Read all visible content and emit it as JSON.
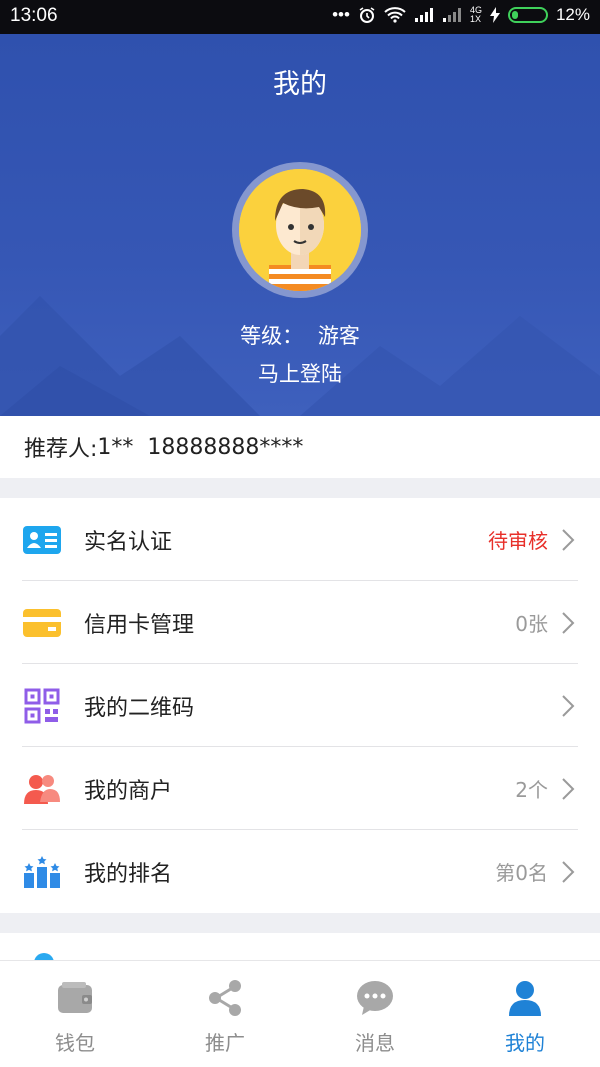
{
  "status_bar": {
    "time": "13:06",
    "network": "4G",
    "network_sub": "1X",
    "battery": "12%"
  },
  "header": {
    "title": "我的",
    "level_label": "等级：",
    "level_value": "游客",
    "login_link": "马上登陆"
  },
  "referrer": {
    "label": "推荐人:",
    "value": "1**  18888888****"
  },
  "menu": {
    "items": [
      {
        "label": "实名认证",
        "value": "待审核",
        "icon": "id-card-icon"
      },
      {
        "label": "信用卡管理",
        "value": "0张",
        "icon": "credit-card-icon"
      },
      {
        "label": "我的二维码",
        "value": "",
        "icon": "qr-code-icon"
      },
      {
        "label": "我的商户",
        "value": "2个",
        "icon": "merchants-icon"
      },
      {
        "label": "我的排名",
        "value": "第0名",
        "icon": "ranking-icon"
      }
    ]
  },
  "tabs": [
    {
      "label": "钱包",
      "icon": "wallet-icon",
      "active": false
    },
    {
      "label": "推广",
      "icon": "share-icon",
      "active": false
    },
    {
      "label": "消息",
      "icon": "message-icon",
      "active": false
    },
    {
      "label": "我的",
      "icon": "user-icon",
      "active": true
    }
  ],
  "colors": {
    "header_bg": "#3657b5",
    "pending": "#e8302a",
    "active_tab": "#1f82d6"
  }
}
